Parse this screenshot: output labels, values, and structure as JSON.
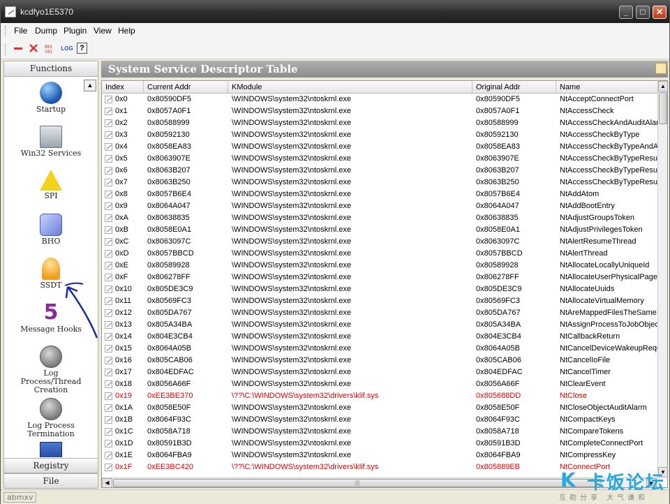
{
  "window": {
    "title": "kcdfyo1E5370"
  },
  "menu": [
    "File",
    "Dump",
    "Plugin",
    "View",
    "Help"
  ],
  "toolbar": {
    "log_label": "LOG",
    "help_label": "?"
  },
  "sidebar": {
    "header": "Functions",
    "items": [
      {
        "label": "Startup",
        "icon": "globe-icon"
      },
      {
        "label": "Win32 Services",
        "icon": "computer-icon"
      },
      {
        "label": "SPI",
        "icon": "warning-icon"
      },
      {
        "label": "BHO",
        "icon": "bho-icon"
      },
      {
        "label": "SSDT",
        "icon": "bell-icon"
      },
      {
        "label": "Message Hooks",
        "icon": "number-five-icon"
      },
      {
        "label": "Log Process/Thread Creation",
        "icon": "process-log-icon"
      },
      {
        "label": "Log Process Termination",
        "icon": "termination-log-icon"
      }
    ],
    "footer_registry": "Registry",
    "footer_file": "File"
  },
  "content": {
    "title": "System Service Descriptor Table"
  },
  "table": {
    "columns": [
      "Index",
      "Current Addr",
      "KModule",
      "Original Addr",
      "Name"
    ],
    "rows": [
      [
        "0x0",
        "0x80590DF5",
        "\\WINDOWS\\system32\\ntoskrnl.exe",
        "0x80590DF5",
        "NtAcceptConnectPort",
        false
      ],
      [
        "0x1",
        "0x8057A0F1",
        "\\WINDOWS\\system32\\ntoskrnl.exe",
        "0x8057A0F1",
        "NtAccessCheck",
        false
      ],
      [
        "0x2",
        "0x80588999",
        "\\WINDOWS\\system32\\ntoskrnl.exe",
        "0x80588999",
        "NtAccessCheckAndAuditAlarm",
        false
      ],
      [
        "0x3",
        "0x80592130",
        "\\WINDOWS\\system32\\ntoskrnl.exe",
        "0x80592130",
        "NtAccessCheckByType",
        false
      ],
      [
        "0x4",
        "0x8058EA83",
        "\\WINDOWS\\system32\\ntoskrnl.exe",
        "0x8058EA83",
        "NtAccessCheckByTypeAndAuditAlarm",
        false
      ],
      [
        "0x5",
        "0x8063907E",
        "\\WINDOWS\\system32\\ntoskrnl.exe",
        "0x8063907E",
        "NtAccessCheckByTypeResultList",
        false
      ],
      [
        "0x6",
        "0x8063B207",
        "\\WINDOWS\\system32\\ntoskrnl.exe",
        "0x8063B207",
        "NtAccessCheckByTypeResultListAndAuditAlarm",
        false
      ],
      [
        "0x7",
        "0x8063B250",
        "\\WINDOWS\\system32\\ntoskrnl.exe",
        "0x8063B250",
        "NtAccessCheckByTypeResultListAndAuditAlarmByHandle",
        false
      ],
      [
        "0x8",
        "0x8057B6E4",
        "\\WINDOWS\\system32\\ntoskrnl.exe",
        "0x8057B6E4",
        "NtAddAtom",
        false
      ],
      [
        "0x9",
        "0x8064A047",
        "\\WINDOWS\\system32\\ntoskrnl.exe",
        "0x8064A047",
        "NtAddBootEntry",
        false
      ],
      [
        "0xA",
        "0x80638835",
        "\\WINDOWS\\system32\\ntoskrnl.exe",
        "0x80638835",
        "NtAdjustGroupsToken",
        false
      ],
      [
        "0xB",
        "0x8058E0A1",
        "\\WINDOWS\\system32\\ntoskrnl.exe",
        "0x8058E0A1",
        "NtAdjustPrivilegesToken",
        false
      ],
      [
        "0xC",
        "0x8063097C",
        "\\WINDOWS\\system32\\ntoskrnl.exe",
        "0x8063097C",
        "NtAlertResumeThread",
        false
      ],
      [
        "0xD",
        "0x8057BBCD",
        "\\WINDOWS\\system32\\ntoskrnl.exe",
        "0x8057BBCD",
        "NtAlertThread",
        false
      ],
      [
        "0xE",
        "0x80589928",
        "\\WINDOWS\\system32\\ntoskrnl.exe",
        "0x80589928",
        "NtAllocateLocallyUniqueId",
        false
      ],
      [
        "0xF",
        "0x806278FF",
        "\\WINDOWS\\system32\\ntoskrnl.exe",
        "0x806278FF",
        "NtAllocateUserPhysicalPages",
        false
      ],
      [
        "0x10",
        "0x805DE3C9",
        "\\WINDOWS\\system32\\ntoskrnl.exe",
        "0x805DE3C9",
        "NtAllocateUuids",
        false
      ],
      [
        "0x11",
        "0x80569FC3",
        "\\WINDOWS\\system32\\ntoskrnl.exe",
        "0x80569FC3",
        "NtAllocateVirtualMemory",
        false
      ],
      [
        "0x12",
        "0x805DA767",
        "\\WINDOWS\\system32\\ntoskrnl.exe",
        "0x805DA767",
        "NtAreMappedFilesTheSame",
        false
      ],
      [
        "0x13",
        "0x805A34BA",
        "\\WINDOWS\\system32\\ntoskrnl.exe",
        "0x805A34BA",
        "NtAssignProcessToJobObject",
        false
      ],
      [
        "0x14",
        "0x804E3CB4",
        "\\WINDOWS\\system32\\ntoskrnl.exe",
        "0x804E3CB4",
        "NtCallbackReturn",
        false
      ],
      [
        "0x15",
        "0x8064A05B",
        "\\WINDOWS\\system32\\ntoskrnl.exe",
        "0x8064A05B",
        "NtCancelDeviceWakeupRequest",
        false
      ],
      [
        "0x16",
        "0x805CAB06",
        "\\WINDOWS\\system32\\ntoskrnl.exe",
        "0x805CAB06",
        "NtCancelIoFile",
        false
      ],
      [
        "0x17",
        "0x804EDFAC",
        "\\WINDOWS\\system32\\ntoskrnl.exe",
        "0x804EDFAC",
        "NtCancelTimer",
        false
      ],
      [
        "0x18",
        "0x8056A66F",
        "\\WINDOWS\\system32\\ntoskrnl.exe",
        "0x8056A66F",
        "NtClearEvent",
        false
      ],
      [
        "0x19",
        "0xEE3BE370",
        "\\??\\C:\\WINDOWS\\system32\\drivers\\klif.sys",
        "0x805688DD",
        "NtClose",
        true
      ],
      [
        "0x1A",
        "0x8058E50F",
        "\\WINDOWS\\system32\\ntoskrnl.exe",
        "0x8058E50F",
        "NtCloseObjectAuditAlarm",
        false
      ],
      [
        "0x1B",
        "0x8064F93C",
        "\\WINDOWS\\system32\\ntoskrnl.exe",
        "0x8064F93C",
        "NtCompactKeys",
        false
      ],
      [
        "0x1C",
        "0x8058A718",
        "\\WINDOWS\\system32\\ntoskrnl.exe",
        "0x8058A718",
        "NtCompareTokens",
        false
      ],
      [
        "0x1D",
        "0x80591B3D",
        "\\WINDOWS\\system32\\ntoskrnl.exe",
        "0x80591B3D",
        "NtCompleteConnectPort",
        false
      ],
      [
        "0x1E",
        "0x8064FBA9",
        "\\WINDOWS\\system32\\ntoskrnl.exe",
        "0x8064FBA9",
        "NtCompressKey",
        false
      ],
      [
        "0x1F",
        "0xEE3BC420",
        "\\??\\C:\\WINDOWS\\system32\\drivers\\klif.sys",
        "0x805889EB",
        "NtConnectPort",
        true
      ]
    ]
  },
  "status": {
    "text": "abmxv"
  },
  "watermark": {
    "main": "卡饭论坛",
    "sub": "互助分享 大气谦和"
  },
  "colors": {
    "alert": "#e00000",
    "title_bar": "#2e2e2e",
    "content_header": "#9a9a9a"
  }
}
